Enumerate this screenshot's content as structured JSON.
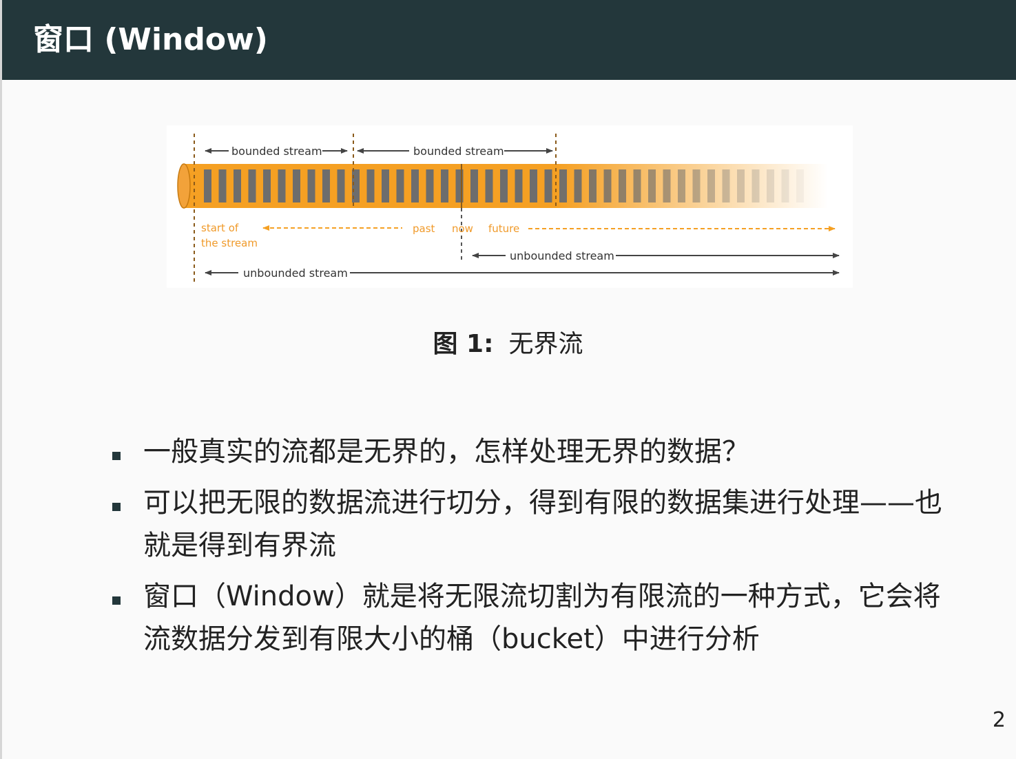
{
  "slide": {
    "title": "窗口 (Window)",
    "page_number": "2"
  },
  "figure": {
    "labels": {
      "bounded_1": "bounded stream",
      "bounded_2": "bounded stream",
      "start_of": "start of",
      "the_stream": "the stream",
      "past": "past",
      "now": "now",
      "future": "future",
      "unbounded_upper": "unbounded stream",
      "unbounded_lower": "unbounded stream"
    },
    "colors": {
      "orange": "#f5a023",
      "bar": "#6d6d6d",
      "arrow": "#444444",
      "dashed": "#f5a023"
    },
    "caption_label": "图 1:",
    "caption_text": "无界流"
  },
  "bullets": [
    {
      "text": "一般真实的流都是无界的，怎样处理无界的数据？"
    },
    {
      "text": "可以把无限的数据流进行切分，得到有限的数据集进行处理——也就是得到有界流"
    },
    {
      "text": "窗口（Window）就是将无限流切割为有限流的一种方式，它会将流数据分发到有限大小的桶（bucket）中进行分析"
    }
  ]
}
